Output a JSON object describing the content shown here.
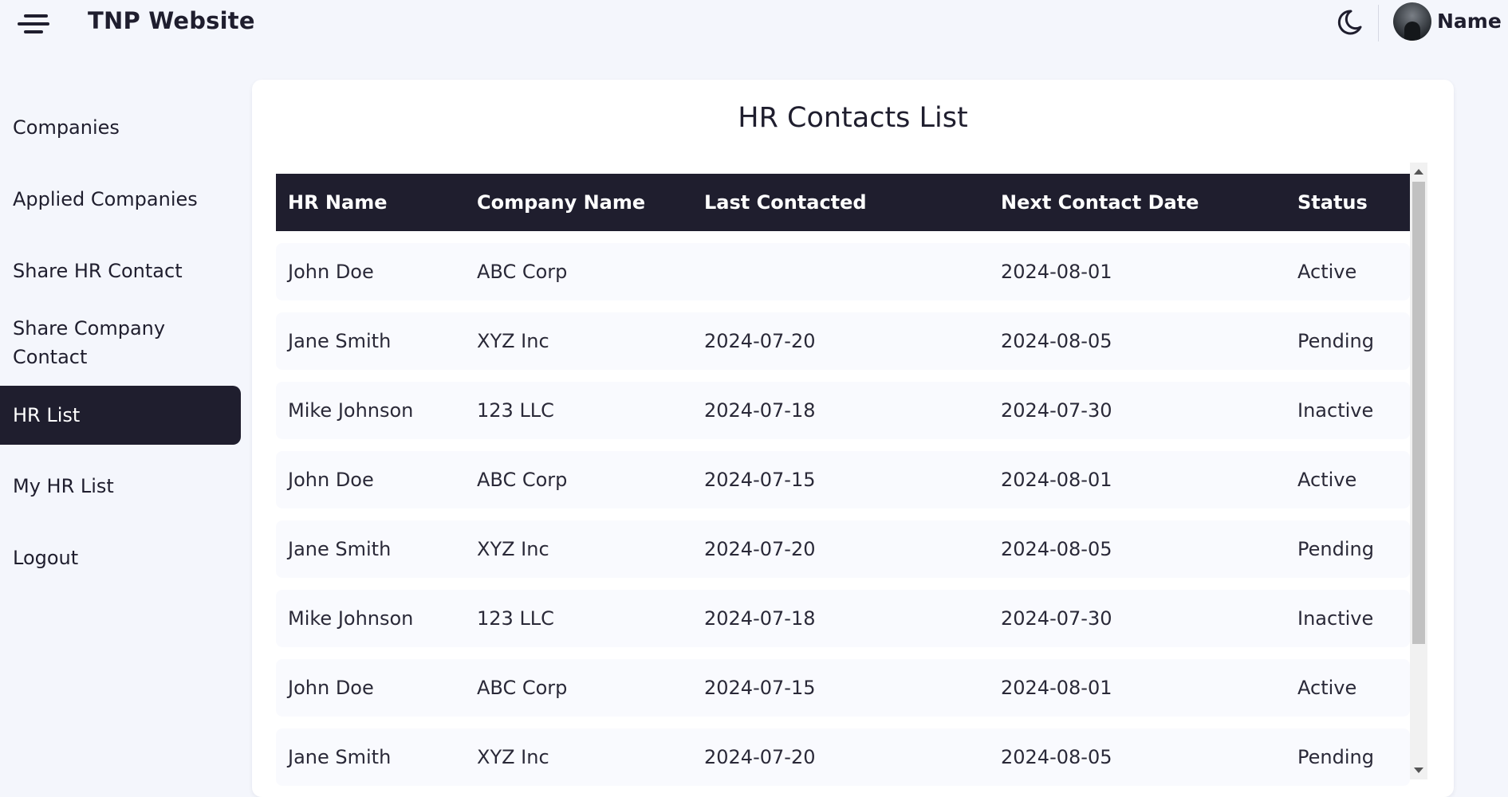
{
  "header": {
    "brand": "TNP Website",
    "user_name": "Name",
    "icons": [
      "menu-icon",
      "moon-icon",
      "avatar"
    ]
  },
  "sidebar": {
    "items": [
      {
        "label": "Companies",
        "active": false
      },
      {
        "label": "Applied Companies",
        "active": false
      },
      {
        "label": "Share HR Contact",
        "active": false
      },
      {
        "label": "Share Company Contact",
        "active": false
      },
      {
        "label": "HR List",
        "active": true
      },
      {
        "label": "My HR List",
        "active": false
      },
      {
        "label": "Logout",
        "active": false
      }
    ]
  },
  "main": {
    "title": "HR Contacts List",
    "columns": [
      "HR Name",
      "Company Name",
      "Last Contacted",
      "Next Contact Date",
      "Status"
    ],
    "rows": [
      [
        "John Doe",
        "ABC Corp",
        "",
        "2024-08-01",
        "Active"
      ],
      [
        "Jane Smith",
        "XYZ Inc",
        "2024-07-20",
        "2024-08-05",
        "Pending"
      ],
      [
        "Mike Johnson",
        "123 LLC",
        "2024-07-18",
        "2024-07-30",
        "Inactive"
      ],
      [
        "John Doe",
        "ABC Corp",
        "2024-07-15",
        "2024-08-01",
        "Active"
      ],
      [
        "Jane Smith",
        "XYZ Inc",
        "2024-07-20",
        "2024-08-05",
        "Pending"
      ],
      [
        "Mike Johnson",
        "123 LLC",
        "2024-07-18",
        "2024-07-30",
        "Inactive"
      ],
      [
        "John Doe",
        "ABC Corp",
        "2024-07-15",
        "2024-08-01",
        "Active"
      ],
      [
        "Jane Smith",
        "XYZ Inc",
        "2024-07-20",
        "2024-08-05",
        "Pending"
      ]
    ]
  },
  "colors": {
    "dark": "#1f1e2e",
    "background": "#f4f6fc",
    "card": "#ffffff",
    "row": "#f9fafe"
  }
}
